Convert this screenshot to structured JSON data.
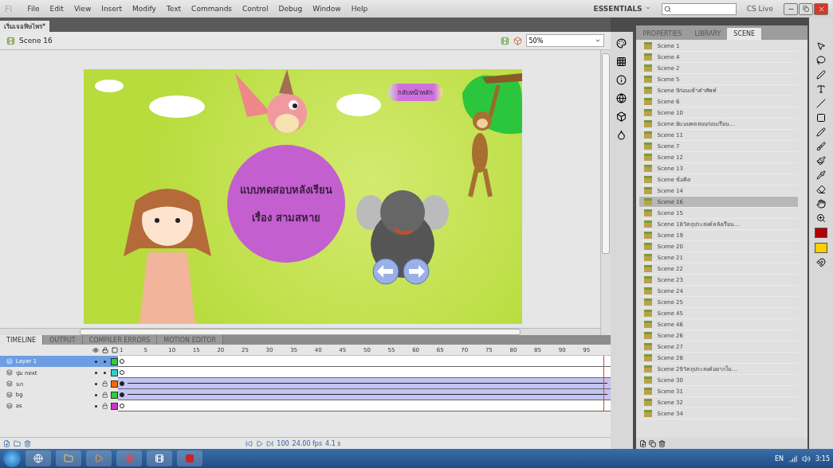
{
  "menu": {
    "logo": "Fl",
    "items": [
      "File",
      "Edit",
      "View",
      "Insert",
      "Modify",
      "Text",
      "Commands",
      "Control",
      "Debug",
      "Window",
      "Help"
    ],
    "workspace": "ESSENTIALS",
    "cs_live": "CS Live"
  },
  "document_tab": {
    "title": "เริ่มเจอพิษไพร*"
  },
  "scene_bar": {
    "scene": "Scene 16",
    "zoom": "50%"
  },
  "stage": {
    "back_button": "กลับหน้าหลัก",
    "title_lines": [
      "แบบทดสอบหลังเรียน",
      "เรื่อง สามสหาย"
    ]
  },
  "timeline": {
    "tabs": [
      {
        "label": "TIMELINE",
        "selected": true
      },
      {
        "label": "OUTPUT",
        "selected": false
      },
      {
        "label": "COMPILER ERRORS",
        "selected": false
      },
      {
        "label": "MOTION EDITOR",
        "selected": false
      }
    ],
    "frame_numbers": [
      "1",
      "5",
      "10",
      "15",
      "20",
      "25",
      "30",
      "35",
      "40",
      "45",
      "50",
      "55",
      "60",
      "65",
      "70",
      "75",
      "80",
      "85",
      "90",
      "95"
    ],
    "layers": [
      {
        "name": "Layer 1",
        "selected": true,
        "locked": false,
        "tween": false,
        "color": "#33cc33"
      },
      {
        "name": "ปุ่ม next",
        "selected": false,
        "locked": false,
        "tween": false,
        "color": "#33cccc"
      },
      {
        "name": "นก",
        "selected": false,
        "locked": true,
        "tween": true,
        "color": "#ff6600"
      },
      {
        "name": "bg",
        "selected": false,
        "locked": true,
        "tween": true,
        "color": "#33cc33"
      },
      {
        "name": "as",
        "selected": false,
        "locked": true,
        "tween": false,
        "color": "#cc33cc"
      }
    ],
    "current_frame": "100",
    "fps": "24.00 fps",
    "time": "4.1 s"
  },
  "panel": {
    "tabs": [
      {
        "label": "PROPERTIES",
        "selected": false
      },
      {
        "label": "LIBRARY",
        "selected": false
      },
      {
        "label": "SCENE",
        "selected": true
      }
    ],
    "scenes": [
      {
        "name": "Scene 1",
        "selected": false
      },
      {
        "name": "Scene 4",
        "selected": false
      },
      {
        "name": "Scene 2",
        "selected": false
      },
      {
        "name": "Scene 5",
        "selected": false
      },
      {
        "name": "Scene 9ก่อนเข้าคำศัพท์",
        "selected": false
      },
      {
        "name": "Scene 6",
        "selected": false
      },
      {
        "name": "Scene 10",
        "selected": false
      },
      {
        "name": "Scene 8แบบทดสอบก่อนเรียน...",
        "selected": false
      },
      {
        "name": "Scene 11",
        "selected": false
      },
      {
        "name": "Scene 7",
        "selected": false
      },
      {
        "name": "Scene 12",
        "selected": false
      },
      {
        "name": "Scene 13",
        "selected": false
      },
      {
        "name": "Scene ข้อคิด",
        "selected": false
      },
      {
        "name": "Scene 14",
        "selected": false
      },
      {
        "name": "Scene 16",
        "selected": true
      },
      {
        "name": "Scene 15",
        "selected": false
      },
      {
        "name": "Scene 18วัตถุประสงค์หลังเรียน...",
        "selected": false
      },
      {
        "name": "Scene 19",
        "selected": false
      },
      {
        "name": "Scene 20",
        "selected": false
      },
      {
        "name": "Scene 21",
        "selected": false
      },
      {
        "name": "Scene 22",
        "selected": false
      },
      {
        "name": "Scene 23",
        "selected": false
      },
      {
        "name": "Scene 24",
        "selected": false
      },
      {
        "name": "Scene 25",
        "selected": false
      },
      {
        "name": "Scene 45",
        "selected": false
      },
      {
        "name": "Scene 46",
        "selected": false
      },
      {
        "name": "Scene 26",
        "selected": false
      },
      {
        "name": "Scene 27",
        "selected": false
      },
      {
        "name": "Scene 28",
        "selected": false
      },
      {
        "name": "Scene 29วัตถุประสงค์อยากใน...",
        "selected": false
      },
      {
        "name": "Scene 30",
        "selected": false
      },
      {
        "name": "Scene 31",
        "selected": false
      },
      {
        "name": "Scene 32",
        "selected": false
      },
      {
        "name": "Scene 34",
        "selected": false
      }
    ]
  },
  "taskbar": {
    "language": "EN",
    "clock": "3:15"
  }
}
